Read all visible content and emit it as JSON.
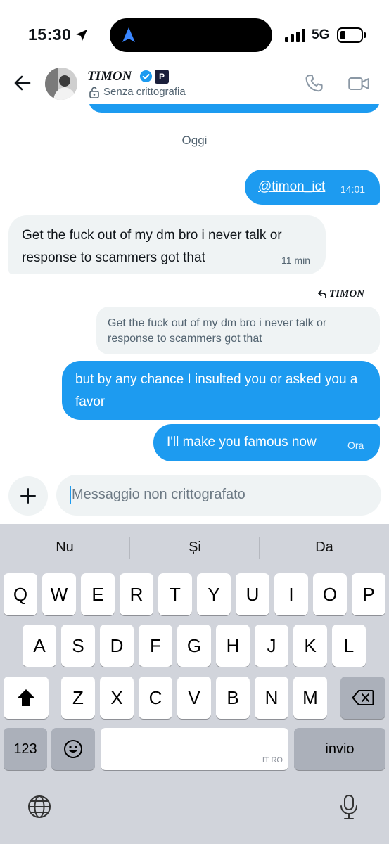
{
  "status_bar": {
    "time": "15:30",
    "network": "5G"
  },
  "header": {
    "name": "TIMON",
    "affiliate_badge": "P",
    "encryption_status": "Senza crittografia"
  },
  "conversation": {
    "day_separator": "Oggi",
    "messages": [
      {
        "direction": "out",
        "text": "@timon_ict",
        "time": "14:01"
      },
      {
        "direction": "in",
        "text": "Get the fuck out of my dm bro i never talk or response to scammers got that",
        "time": "11 min"
      },
      {
        "direction": "out",
        "reply_to_name": "TIMON",
        "quoted_text": "Get the fuck out of my dm bro i never talk or response to scammers got that",
        "text": "but by any chance I insulted you or asked you a favor"
      },
      {
        "direction": "out",
        "text": "I'll make you famous now",
        "time": "Ora"
      }
    ]
  },
  "composer": {
    "placeholder": "Messaggio non crittografato"
  },
  "keyboard": {
    "suggestions": [
      "Nu",
      "Și",
      "Da"
    ],
    "row1": [
      "Q",
      "W",
      "E",
      "R",
      "T",
      "Y",
      "U",
      "I",
      "O",
      "P"
    ],
    "row2": [
      "A",
      "S",
      "D",
      "F",
      "G",
      "H",
      "J",
      "K",
      "L"
    ],
    "row3": [
      "Z",
      "X",
      "C",
      "V",
      "B",
      "N",
      "M"
    ],
    "numbers_key": "123",
    "return_key": "invio",
    "space_languages": "IT RO"
  },
  "colors": {
    "accent": "#1d9bf0",
    "incoming_bubble": "#eff3f4",
    "keyboard_bg": "#d1d4db"
  },
  "icons": [
    "location-arrow-icon",
    "navigation-icon",
    "signal-icon",
    "battery-icon",
    "back-arrow-icon",
    "verified-badge-icon",
    "lock-icon",
    "phone-icon",
    "video-icon",
    "reply-arrow-icon",
    "plus-icon",
    "shift-icon",
    "backspace-icon",
    "emoji-icon",
    "globe-icon",
    "microphone-icon"
  ]
}
